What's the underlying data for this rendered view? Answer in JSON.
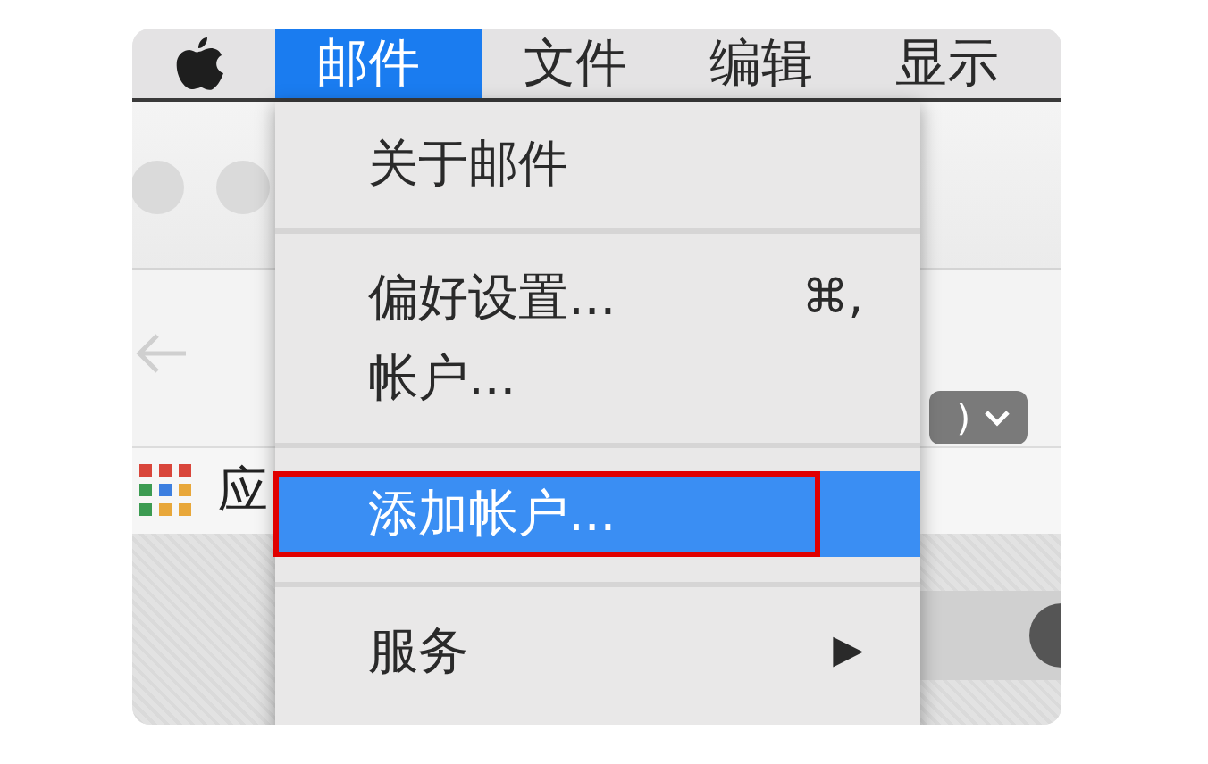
{
  "menu_bar": {
    "items": [
      {
        "label": "邮件",
        "selected": true
      },
      {
        "label": "文件",
        "selected": false
      },
      {
        "label": "编辑",
        "selected": false
      },
      {
        "label": "显示",
        "selected": false
      }
    ]
  },
  "menu": {
    "items": [
      {
        "kind": "item",
        "label": "关于邮件",
        "selected": false
      },
      {
        "kind": "separator"
      },
      {
        "kind": "item",
        "label": "偏好设置...",
        "shortcut": "⌘,",
        "selected": false
      },
      {
        "kind": "item",
        "label": "帐户...",
        "selected": false
      },
      {
        "kind": "separator"
      },
      {
        "kind": "item",
        "label": "添加帐户...",
        "selected": true,
        "annotated": true
      },
      {
        "kind": "separator"
      },
      {
        "kind": "submenu",
        "label": "服务",
        "arrow": "▶",
        "selected": false
      }
    ]
  },
  "background_window": {
    "bookmark_label": "应",
    "dropdown_text": ")"
  }
}
